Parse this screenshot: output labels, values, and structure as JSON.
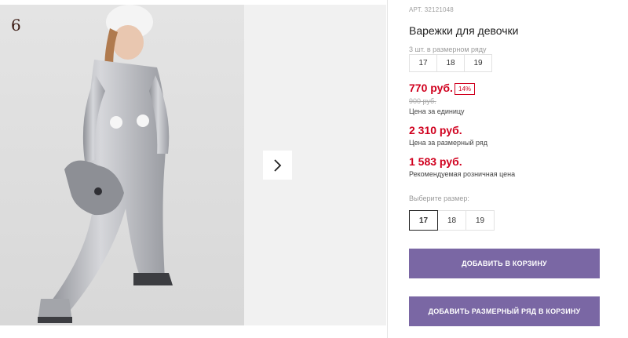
{
  "gallery": {
    "slide_number": "6",
    "next_icon": "chevron-right-icon"
  },
  "product": {
    "article": "АРТ. 32121048",
    "title": "Варежки для девочки",
    "pack_label": "3 шт. в размерном ряду",
    "pack_sizes": [
      "17",
      "18",
      "19"
    ],
    "price": "770 руб.",
    "discount": "14%",
    "old_price": "900 руб.",
    "price_note": "Цена за единицу",
    "row_price": "2 310 руб.",
    "row_price_note": "Цена за размерный ряд",
    "retail_price": "1 583 руб.",
    "retail_note": "Рекомендуемая розничная цена",
    "choose_size_label": "Выберите размер:",
    "sizes": [
      "17",
      "18",
      "19"
    ],
    "selected_size": "17"
  },
  "actions": {
    "add_to_cart": "ДОБАВИТЬ В КОРЗИНУ",
    "add_row_to_cart": "ДОБАВИТЬ РАЗМЕРНЫЙ РЯД В КОРЗИНУ"
  },
  "colors": {
    "price": "#d0001e",
    "button": "#7a67a4"
  }
}
